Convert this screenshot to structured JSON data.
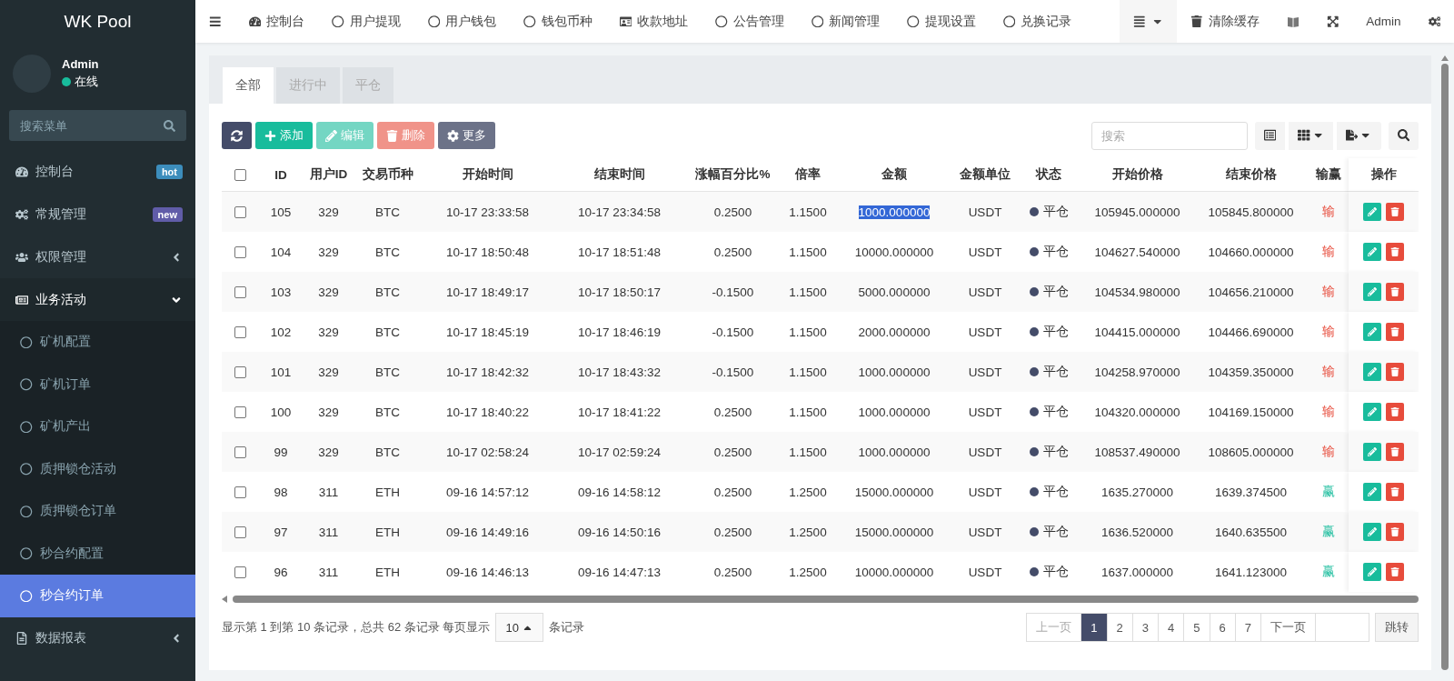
{
  "sidebar": {
    "logo": "WK Pool",
    "user": {
      "name": "Admin",
      "status": "在线",
      "online": true
    },
    "search": {
      "placeholder": "搜索菜单"
    },
    "items": [
      {
        "label": "控制台",
        "badge": {
          "text": "hot",
          "color": "#3c8dbc"
        }
      },
      {
        "label": "常规管理",
        "badge": {
          "text": "new",
          "color": "#605ca8"
        }
      },
      {
        "label": "权限管理",
        "expanded": false
      },
      {
        "label": "业务活动",
        "expanded": true,
        "children": [
          {
            "label": "矿机配置",
            "selected": false
          },
          {
            "label": "矿机订单",
            "selected": false
          },
          {
            "label": "矿机产出",
            "selected": false
          },
          {
            "label": "质押锁仓活动",
            "selected": false
          },
          {
            "label": "质押锁仓订单",
            "selected": false
          },
          {
            "label": "秒合约配置",
            "selected": false
          },
          {
            "label": "秒合约订单",
            "selected": true
          }
        ]
      },
      {
        "label": "数据报表",
        "expanded": false
      }
    ]
  },
  "topbar": {
    "nav": [
      {
        "label": "控制台"
      },
      {
        "label": "用户提现"
      },
      {
        "label": "用户钱包"
      },
      {
        "label": "钱包币种"
      },
      {
        "label": "收款地址"
      },
      {
        "label": "公告管理"
      },
      {
        "label": "新闻管理"
      },
      {
        "label": "提现设置"
      },
      {
        "label": "兑换记录"
      }
    ],
    "clear_cache": "清除缓存",
    "user": "Admin"
  },
  "tabs": [
    {
      "label": "全部",
      "selected": true
    },
    {
      "label": "进行中",
      "selected": false
    },
    {
      "label": "平仓",
      "selected": false
    }
  ],
  "toolbar": {
    "buttons": [
      {
        "kind": "refresh",
        "disabled": false
      },
      {
        "kind": "add",
        "label": "添加",
        "disabled": false
      },
      {
        "kind": "edit",
        "label": "编辑",
        "disabled": true
      },
      {
        "kind": "delete",
        "label": "删除",
        "disabled": true
      },
      {
        "kind": "more",
        "label": "更多",
        "disabled": false
      }
    ],
    "search": {
      "placeholder": "搜索"
    }
  },
  "table": {
    "select_all": {
      "checked": false
    },
    "columns": [
      "ID",
      "用户ID",
      "交易币种",
      "开始时间",
      "结束时间",
      "涨幅百分比%",
      "倍率",
      "金额",
      "金额单位",
      "状态",
      "开始价格",
      "结束价格",
      "输赢",
      "操作"
    ],
    "rows": [
      {
        "checked": false,
        "id": "105",
        "user_id": "329",
        "symbol": "BTC",
        "start_time": "10-17 23:33:58",
        "end_time": "10-17 23:34:58",
        "change": "0.2500",
        "rate": "1.1500",
        "amount": "1000.000000",
        "amount_selected": true,
        "unit": "USDT",
        "status": "平仓",
        "start_price": "105945.000000",
        "end_price": "105845.800000",
        "result": "输",
        "won": false
      },
      {
        "checked": false,
        "id": "104",
        "user_id": "329",
        "symbol": "BTC",
        "start_time": "10-17 18:50:48",
        "end_time": "10-17 18:51:48",
        "change": "0.2500",
        "rate": "1.1500",
        "amount": "10000.000000",
        "amount_selected": false,
        "unit": "USDT",
        "status": "平仓",
        "start_price": "104627.540000",
        "end_price": "104660.000000",
        "result": "输",
        "won": false
      },
      {
        "checked": false,
        "id": "103",
        "user_id": "329",
        "symbol": "BTC",
        "start_time": "10-17 18:49:17",
        "end_time": "10-17 18:50:17",
        "change": "-0.1500",
        "rate": "1.1500",
        "amount": "5000.000000",
        "amount_selected": false,
        "unit": "USDT",
        "status": "平仓",
        "start_price": "104534.980000",
        "end_price": "104656.210000",
        "result": "输",
        "won": false
      },
      {
        "checked": false,
        "id": "102",
        "user_id": "329",
        "symbol": "BTC",
        "start_time": "10-17 18:45:19",
        "end_time": "10-17 18:46:19",
        "change": "-0.1500",
        "rate": "1.1500",
        "amount": "2000.000000",
        "amount_selected": false,
        "unit": "USDT",
        "status": "平仓",
        "start_price": "104415.000000",
        "end_price": "104466.690000",
        "result": "输",
        "won": false
      },
      {
        "checked": false,
        "id": "101",
        "user_id": "329",
        "symbol": "BTC",
        "start_time": "10-17 18:42:32",
        "end_time": "10-17 18:43:32",
        "change": "-0.1500",
        "rate": "1.1500",
        "amount": "1000.000000",
        "amount_selected": false,
        "unit": "USDT",
        "status": "平仓",
        "start_price": "104258.970000",
        "end_price": "104359.350000",
        "result": "输",
        "won": false
      },
      {
        "checked": false,
        "id": "100",
        "user_id": "329",
        "symbol": "BTC",
        "start_time": "10-17 18:40:22",
        "end_time": "10-17 18:41:22",
        "change": "0.2500",
        "rate": "1.1500",
        "amount": "1000.000000",
        "amount_selected": false,
        "unit": "USDT",
        "status": "平仓",
        "start_price": "104320.000000",
        "end_price": "104169.150000",
        "result": "输",
        "won": false
      },
      {
        "checked": false,
        "id": "99",
        "user_id": "329",
        "symbol": "BTC",
        "start_time": "10-17 02:58:24",
        "end_time": "10-17 02:59:24",
        "change": "0.2500",
        "rate": "1.1500",
        "amount": "1000.000000",
        "amount_selected": false,
        "unit": "USDT",
        "status": "平仓",
        "start_price": "108537.490000",
        "end_price": "108605.000000",
        "result": "输",
        "won": false
      },
      {
        "checked": false,
        "id": "98",
        "user_id": "311",
        "symbol": "ETH",
        "start_time": "09-16 14:57:12",
        "end_time": "09-16 14:58:12",
        "change": "0.2500",
        "rate": "1.2500",
        "amount": "15000.000000",
        "amount_selected": false,
        "unit": "USDT",
        "status": "平仓",
        "start_price": "1635.270000",
        "end_price": "1639.374500",
        "result": "赢",
        "won": true
      },
      {
        "checked": false,
        "id": "97",
        "user_id": "311",
        "symbol": "ETH",
        "start_time": "09-16 14:49:16",
        "end_time": "09-16 14:50:16",
        "change": "0.2500",
        "rate": "1.2500",
        "amount": "15000.000000",
        "amount_selected": false,
        "unit": "USDT",
        "status": "平仓",
        "start_price": "1636.520000",
        "end_price": "1640.635500",
        "result": "赢",
        "won": true
      },
      {
        "checked": false,
        "id": "96",
        "user_id": "311",
        "symbol": "ETH",
        "start_time": "09-16 14:46:13",
        "end_time": "09-16 14:47:13",
        "change": "0.2500",
        "rate": "1.2500",
        "amount": "10000.000000",
        "amount_selected": false,
        "unit": "USDT",
        "status": "平仓",
        "start_price": "1637.000000",
        "end_price": "1641.123000",
        "result": "赢",
        "won": true
      }
    ]
  },
  "footer": {
    "summary": "显示第 1 到第 10 条记录，总共 62 条记录 每页显示",
    "page_size": "10",
    "suffix": "条记录"
  },
  "pagination": {
    "prev": {
      "label": "上一页",
      "disabled": true
    },
    "pages": [
      {
        "label": "1",
        "selected": true
      },
      {
        "label": "2",
        "selected": false
      },
      {
        "label": "3",
        "selected": false
      },
      {
        "label": "4",
        "selected": false
      },
      {
        "label": "5",
        "selected": false
      },
      {
        "label": "6",
        "selected": false
      },
      {
        "label": "7",
        "selected": false
      }
    ],
    "next": {
      "label": "下一页",
      "disabled": false
    },
    "jump": "跳转"
  }
}
